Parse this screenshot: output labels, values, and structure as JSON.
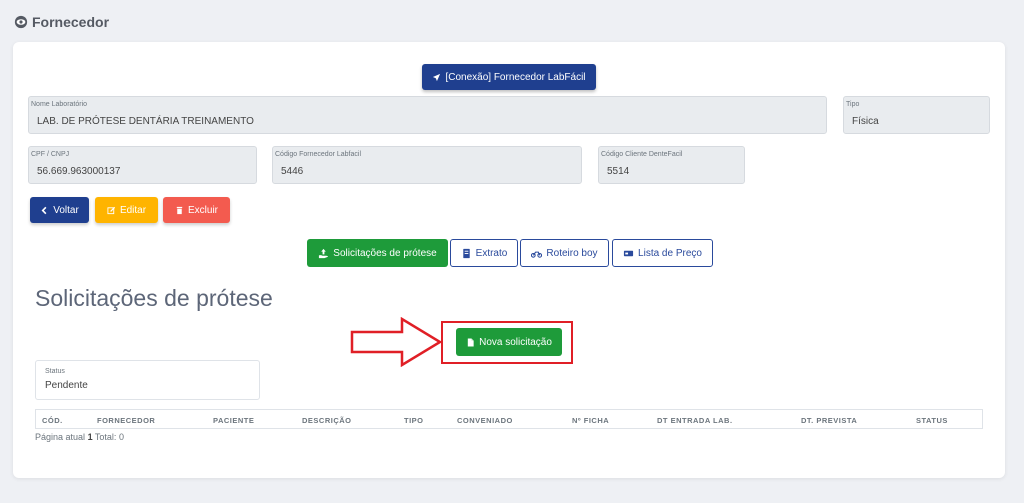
{
  "header": {
    "title": "Fornecedor",
    "icon": "eye-icon"
  },
  "connect_button": {
    "label": "[Conexão] Fornecedor LabFácil"
  },
  "fields": {
    "nome_laboratorio": {
      "label": "Nome Laboratório",
      "value": "LAB. DE PRÓTESE DENTÁRIA TREINAMENTO"
    },
    "tipo": {
      "label": "Tipo",
      "value": "Física"
    },
    "cpf_cnpj": {
      "label": "CPF / CNPJ",
      "value": "56.669.963000137"
    },
    "codigo_fornecedor": {
      "label": "Código Fornecedor Labfacil",
      "value": "5446"
    },
    "codigo_cliente": {
      "label": "Código Cliente DenteFacil",
      "value": "5514"
    }
  },
  "actions": {
    "back": "Voltar",
    "edit": "Editar",
    "delete": "Excluir"
  },
  "tabs": [
    {
      "label": "Solicitações de prótese",
      "active": true
    },
    {
      "label": "Extrato",
      "active": false
    },
    {
      "label": "Roteiro boy",
      "active": false
    },
    {
      "label": "Lista de Preço",
      "active": false
    }
  ],
  "section": {
    "title": "Solicitações de prótese",
    "new_button": "Nova solicitação"
  },
  "status_filter": {
    "label": "Status",
    "value": "Pendente"
  },
  "table": {
    "columns": [
      "CÓD.",
      "FORNECEDOR",
      "PACIENTE",
      "DESCRIÇÃO",
      "TIPO",
      "CONVENIADO",
      "Nº FICHA",
      "DT ENTRADA LAB.",
      "DT. PREVISTA",
      "STATUS"
    ]
  },
  "pagination": {
    "current_label": "Página atual",
    "current_page": "1",
    "total_label": "Total:",
    "total": "0"
  },
  "colors": {
    "primary": "#1f3f8f",
    "success": "#1e9b3a",
    "warning": "#ffb400",
    "danger": "#f35b4f",
    "highlight": "#e01f26"
  }
}
